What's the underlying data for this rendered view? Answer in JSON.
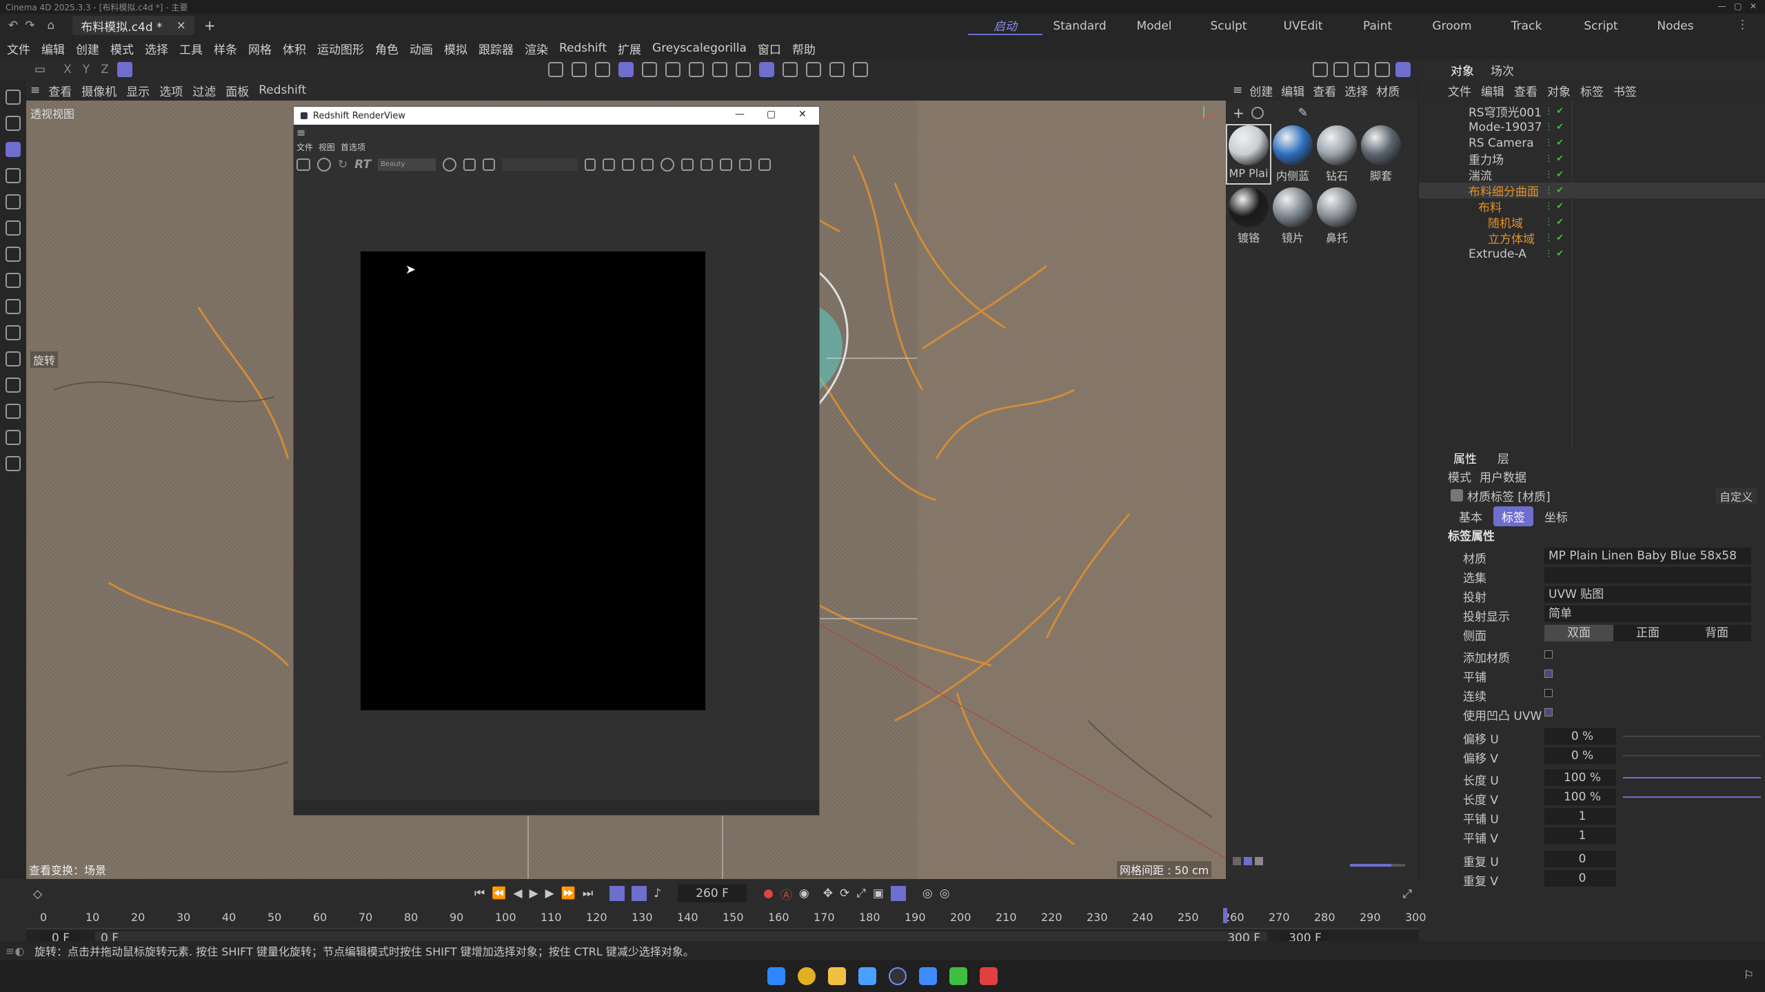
{
  "titlebar": {
    "text": "Cinema 4D 2025.3.3 - [布料模拟.c4d *] - 主要"
  },
  "tabs": {
    "doc": "布料模拟.c4d *",
    "close": "×",
    "add": "+"
  },
  "layouts": [
    "启动",
    "Standard",
    "Model",
    "Sculpt",
    "UVEdit",
    "Paint",
    "Groom",
    "Track",
    "Script",
    "Nodes"
  ],
  "menu": [
    "文件",
    "编辑",
    "创建",
    "模式",
    "选择",
    "工具",
    "样条",
    "网格",
    "体积",
    "运动图形",
    "角色",
    "动画",
    "模拟",
    "跟踪器",
    "渲染",
    "Redshift",
    "扩展",
    "Greyscalegorilla",
    "窗口",
    "帮助"
  ],
  "axes": {
    "x": "X",
    "y": "Y",
    "z": "Z"
  },
  "viewport": {
    "menu": [
      "查看",
      "摄像机",
      "显示",
      "选项",
      "过滤",
      "面板",
      "Redshift"
    ],
    "label": "透视视图",
    "tool_label": "旋转",
    "bottom_left": "查看变换：场景",
    "grid": "网格间距 : 50 cm"
  },
  "renderview": {
    "title": "Redshift RenderView",
    "menu": [
      "文件",
      "视图",
      "首选项"
    ],
    "rt": "RT",
    "aov": "Beauty"
  },
  "materials": {
    "menu": [
      "创建",
      "编辑",
      "查看",
      "选择",
      "材质"
    ],
    "items": [
      "MP Plai",
      "内侧蓝",
      "钻石",
      "脚套",
      "镀铬",
      "镜片",
      "鼻托"
    ]
  },
  "objects": {
    "tabs": [
      "对象",
      "场次"
    ],
    "menu": [
      "文件",
      "编辑",
      "查看",
      "对象",
      "标签",
      "书签"
    ],
    "items": [
      "RS穹顶光001",
      "Mode-19037",
      "RS Camera",
      "重力场",
      "湍流",
      "布料细分曲面",
      "布料",
      "随机域",
      "立方体域",
      "Extrude-A"
    ]
  },
  "attributes": {
    "tabs": [
      "属性",
      "层"
    ],
    "menu": [
      "模式",
      "用户数据"
    ],
    "header": "材质标签 [材质]",
    "preset": "自定义",
    "subtabs": [
      "基本",
      "标签",
      "坐标"
    ],
    "section": "标签属性",
    "material_label": "材质",
    "material_value": "MP Plain Linen Baby Blue 58x58",
    "selection_label": "选集",
    "projection_label": "投射",
    "projection_value": "UVW 贴图",
    "projection_display_label": "投射显示",
    "projection_display_value": "简单",
    "side_label": "侧面",
    "side_options": [
      "双面",
      "正面",
      "背面"
    ],
    "add_material": "添加材质",
    "tile": "平铺",
    "continuous": "连续",
    "use_bump_uvw": "使用凹凸 UVW",
    "offset_u_label": "偏移 U",
    "offset_u": "0 %",
    "offset_v_label": "偏移 V",
    "offset_v": "0 %",
    "length_u_label": "长度 U",
    "length_u": "100 %",
    "length_v_label": "长度 V",
    "length_v": "100 %",
    "tiles_u_label": "平铺 U",
    "tiles_u": "1",
    "tiles_v_label": "平铺 V",
    "tiles_v": "1",
    "repeat_u_label": "重复 U",
    "repeat_u": "0",
    "repeat_v_label": "重复 V",
    "repeat_v": "0"
  },
  "timeline": {
    "ticks": [
      "0",
      "10",
      "20",
      "30",
      "40",
      "50",
      "60",
      "70",
      "80",
      "90",
      "100",
      "110",
      "120",
      "130",
      "140",
      "150",
      "160",
      "170",
      "180",
      "190",
      "200",
      "210",
      "220",
      "230",
      "240",
      "250",
      "260",
      "270",
      "280",
      "290",
      "300"
    ],
    "current_frame": "260 F",
    "start": "0 F",
    "start2": "0 F",
    "end": "300 F",
    "end2": "300 F",
    "playhead_label": "260"
  },
  "status": {
    "text": "旋转：点击并拖动鼠标旋转元素. 按住 SHIFT 键量化旋转；节点编辑模式时按住 SHIFT 键增加选择对象；按住 CTRL 键减少选择对象。"
  },
  "colors": {
    "accent": "#6e6ecf",
    "cloth": "#7d7165",
    "orange": "#e09030"
  }
}
